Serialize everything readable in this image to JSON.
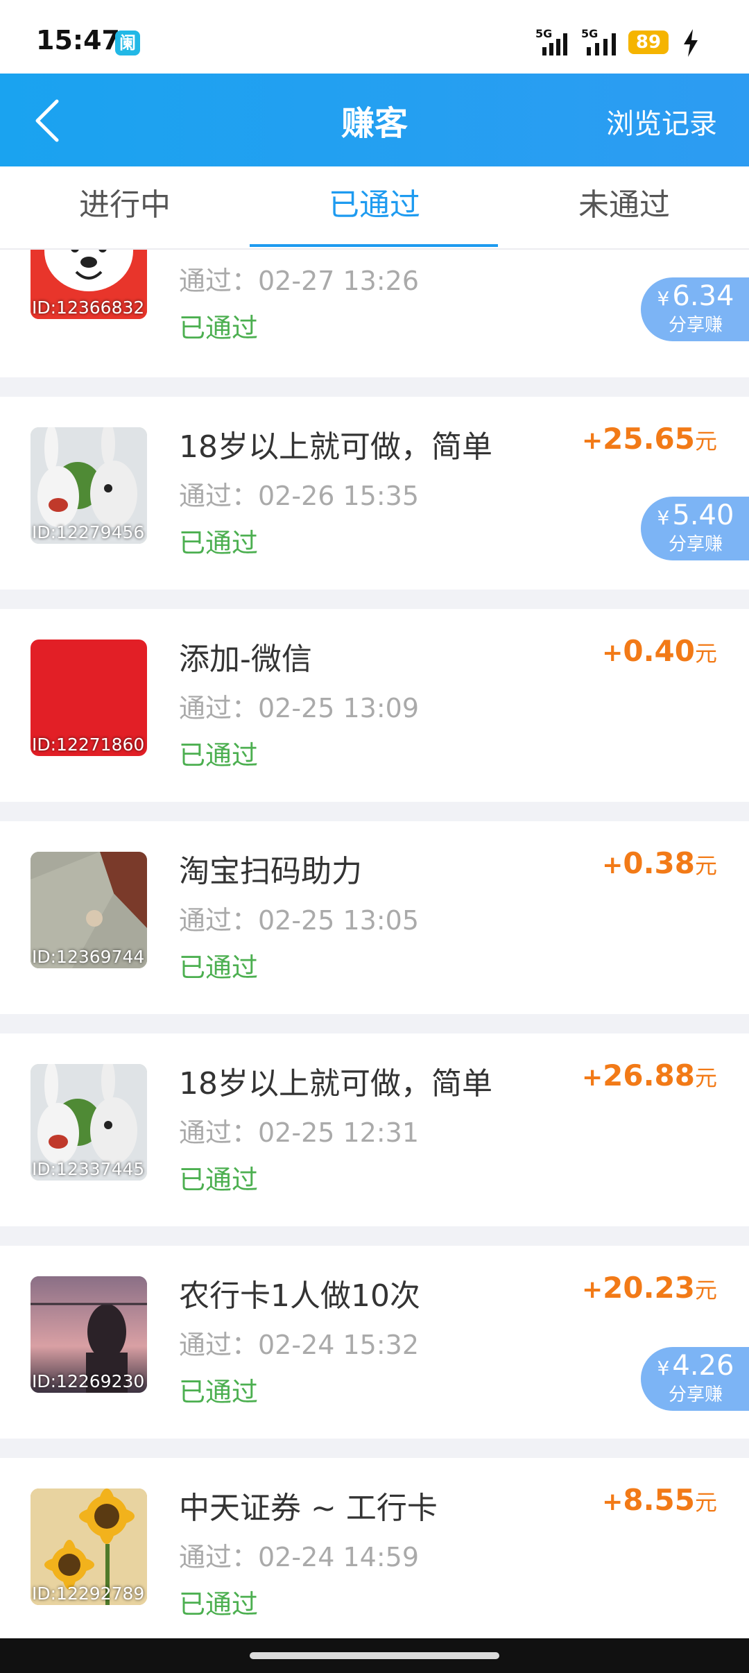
{
  "status_bar": {
    "time": "15:47",
    "app_icon_text": "阑",
    "signal_label_1": "5G",
    "signal_label_2": "5G",
    "battery": "89"
  },
  "header": {
    "title": "赚客",
    "right_link": "浏览记录"
  },
  "tabs": [
    "进行中",
    "已通过",
    "未通过"
  ],
  "tasks": [
    {
      "id": "ID:12366832",
      "title": "",
      "time": "通过：02-27 13:26",
      "status": "已通过",
      "amount": "",
      "share": "6.34",
      "share_label": "分享赚"
    },
    {
      "id": "ID:12279456",
      "title": "18岁以上就可做，简单",
      "time": "通过：02-26 15:35",
      "status": "已通过",
      "amount": "25.65",
      "share": "5.40",
      "share_label": "分享赚"
    },
    {
      "id": "ID:12271860",
      "title": "添加-微信",
      "time": "通过：02-25 13:09",
      "status": "已通过",
      "amount": "0.40"
    },
    {
      "id": "ID:12369744",
      "title": "淘宝扫码助力",
      "time": "通过：02-25 13:05",
      "status": "已通过",
      "amount": "0.38"
    },
    {
      "id": "ID:12337445",
      "title": "18岁以上就可做，简单",
      "time": "通过：02-25 12:31",
      "status": "已通过",
      "amount": "26.88"
    },
    {
      "id": "ID:12269230",
      "title": "农行卡1人做10次",
      "time": "通过：02-24 15:32",
      "status": "已通过",
      "amount": "20.23",
      "share": "4.26",
      "share_label": "分享赚"
    },
    {
      "id": "ID:12292789",
      "title": "中天证券 ~ 工行卡",
      "time": "通过：02-24 14:59",
      "status": "已通过",
      "amount": "8.55"
    }
  ],
  "amount_prefix": "+",
  "amount_unit": "元",
  "yen_symbol": "¥",
  "colors": {
    "header_blue": "#1e9bf0",
    "amount_orange": "#f27a17",
    "status_green": "#4caf50",
    "share_pill": "#7cb4f5"
  }
}
